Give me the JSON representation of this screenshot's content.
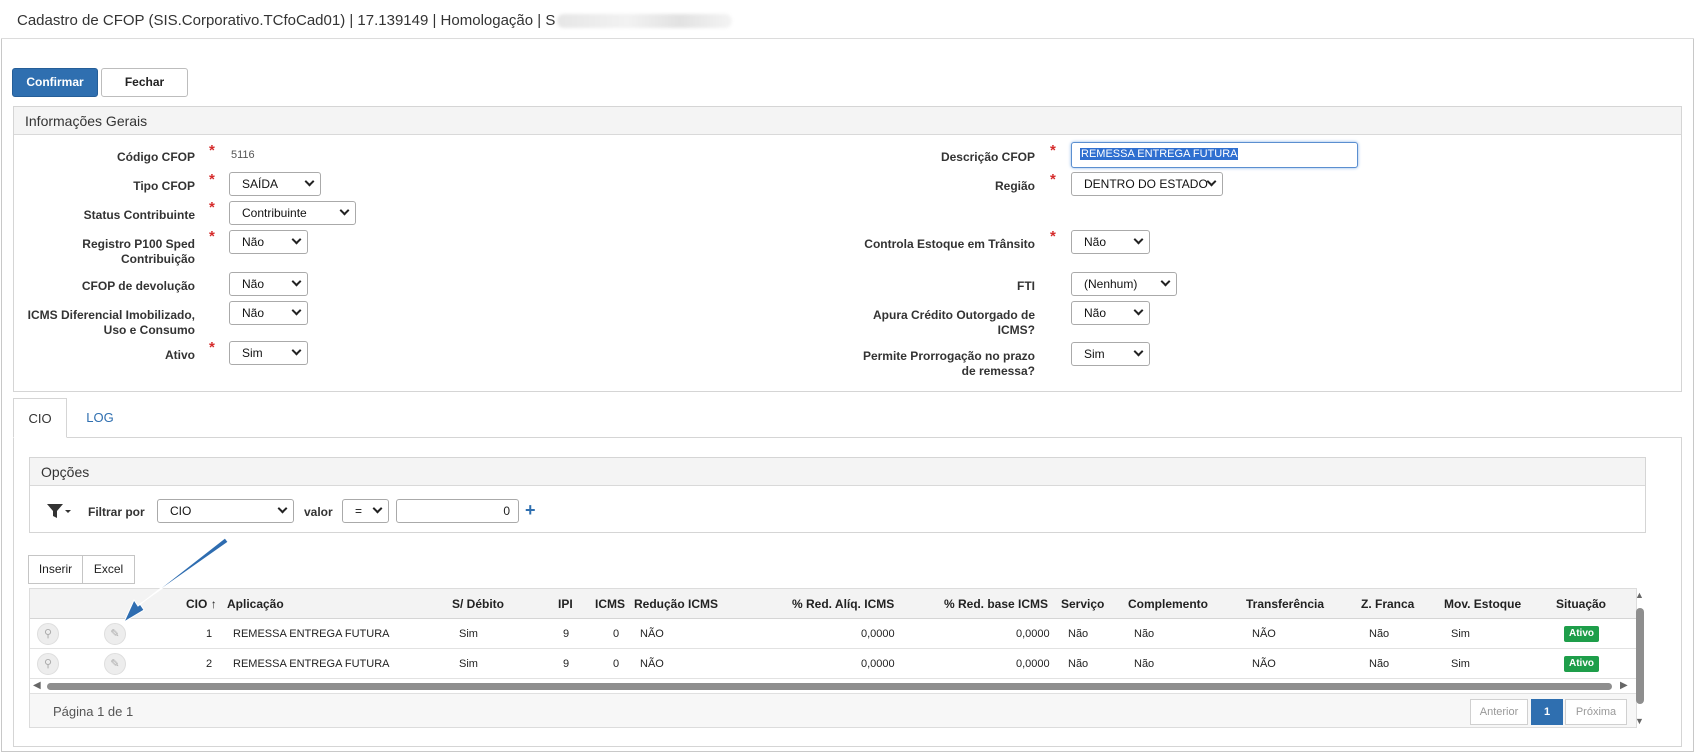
{
  "window": {
    "title": "Cadastro de CFOP (SIS.Corporativo.TCfoCad01) | 17.139149 | Homologação | S"
  },
  "toolbar": {
    "confirm_label": "Confirmar",
    "close_label": "Fechar"
  },
  "general_panel": {
    "title": "Informações Gerais",
    "fields": {
      "codigo_label": "Código CFOP",
      "codigo_value": "5116",
      "tipo_label": "Tipo CFOP",
      "tipo_value": "SAÍDA",
      "status_label": "Status Contribuinte",
      "status_value": "Contribuinte",
      "registro_label_1": "Registro P100 Sped",
      "registro_label_2": "Contribuição",
      "registro_value": "Não",
      "devolucao_label": "CFOP de devolução",
      "devolucao_value": "Não",
      "icms_dif_label_1": "ICMS Diferencial Imobilizado,",
      "icms_dif_label_2": "Uso e Consumo",
      "icms_dif_value": "Não",
      "ativo_label": "Ativo",
      "ativo_value": "Sim",
      "descricao_label": "Descrição CFOP",
      "descricao_value": "REMESSA ENTREGA FUTURA",
      "regiao_label": "Região",
      "regiao_value": "DENTRO DO ESTADO",
      "estoque_label": "Controla Estoque em Trânsito",
      "estoque_value": "Não",
      "fti_label": "FTI",
      "fti_value": "(Nenhum)",
      "apura_label_1": "Apura Crédito Outorgado de",
      "apura_label_2": "ICMS?",
      "apura_value": "Não",
      "prorrog_label_1": "Permite Prorrogação no prazo",
      "prorrog_label_2": "de remessa?",
      "prorrog_value": "Sim"
    },
    "required_mark": "*"
  },
  "tabs": [
    {
      "label": "CIO"
    },
    {
      "label": "LOG"
    }
  ],
  "options_panel": {
    "title": "Opções",
    "filter_by_label": "Filtrar por",
    "filter_field_value": "CIO",
    "value_label": "valor",
    "operator_value": "=",
    "filter_value": "0",
    "add_glyph": "+"
  },
  "grid_actions": {
    "insert_label": "Inserir",
    "excel_label": "Excel"
  },
  "grid": {
    "sort_glyph": "↑",
    "columns": [
      "CIO",
      "Aplicação",
      "S/ Débito",
      "IPI",
      "ICMS",
      "Redução ICMS",
      "% Red. Alíq. ICMS",
      "% Red. base ICMS",
      "Serviço",
      "Complemento",
      "Transferência",
      "Z. Franca",
      "Mov. Estoque",
      "Situação"
    ],
    "rows": [
      {
        "cio": "1",
        "aplicacao": "REMESSA ENTREGA FUTURA",
        "s_debito": "Sim",
        "ipi": "9",
        "icms": "0",
        "reducao": "NÃO",
        "red_aliq": "0,0000",
        "red_base": "0,0000",
        "servico": "Não",
        "complemento": "Não",
        "transferencia": "NÃO",
        "z_franca": "Não",
        "mov_estoque": "Sim",
        "situacao": "Ativo"
      },
      {
        "cio": "2",
        "aplicacao": "REMESSA ENTREGA FUTURA",
        "s_debito": "Sim",
        "ipi": "9",
        "icms": "0",
        "reducao": "NÃO",
        "red_aliq": "0,0000",
        "red_base": "0,0000",
        "servico": "Não",
        "complemento": "Não",
        "transferencia": "NÃO",
        "z_franca": "Não",
        "mov_estoque": "Sim",
        "situacao": "Ativo"
      }
    ],
    "page_info": "Página 1 de 1",
    "pager": {
      "prev": "Anterior",
      "current": "1",
      "next": "Próxima"
    }
  },
  "colors": {
    "primary": "#2f6fb0",
    "required": "#d52b2b",
    "status_active": "#1e9e4a",
    "annotation_arrow": "#1f5a9c"
  },
  "icons": {
    "filter": "filter-icon",
    "search": "search-icon",
    "edit": "edit-icon",
    "arrow": "annotation-arrow-icon"
  }
}
